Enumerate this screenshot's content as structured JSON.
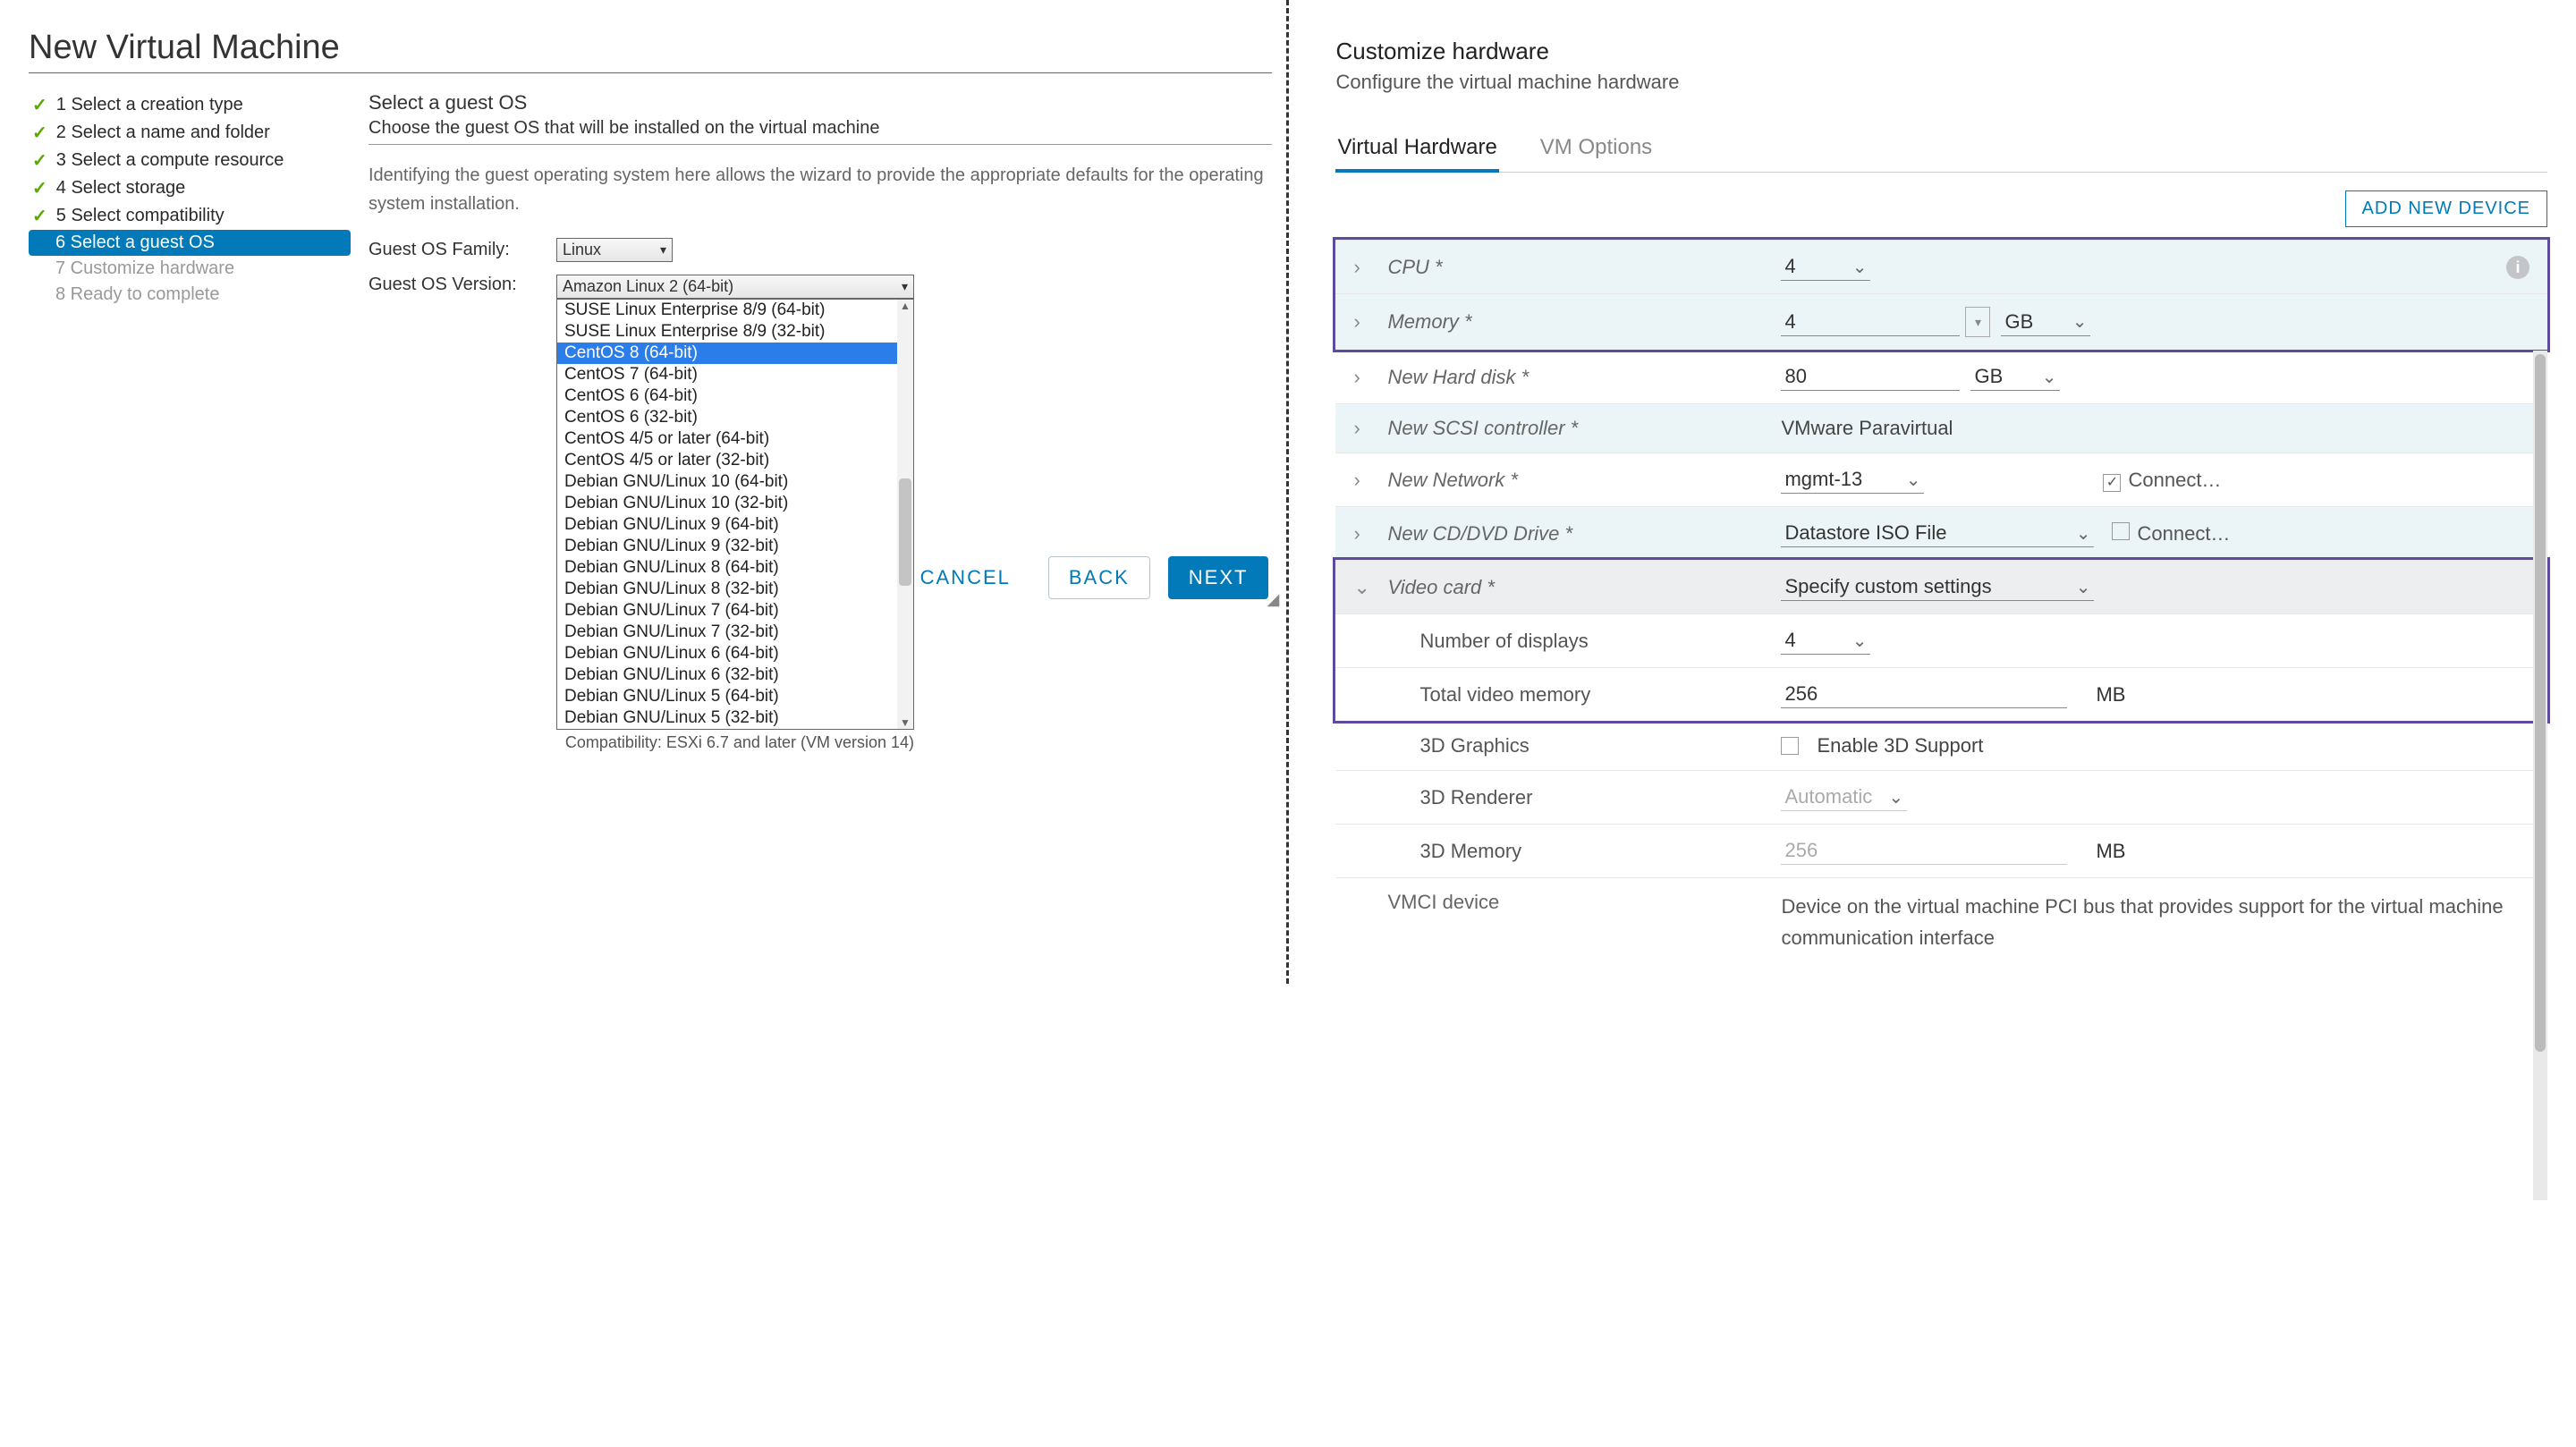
{
  "left": {
    "title": "New Virtual Machine",
    "steps": [
      {
        "num": "1",
        "label": "Select a creation type",
        "state": "done"
      },
      {
        "num": "2",
        "label": "Select a name and folder",
        "state": "done"
      },
      {
        "num": "3",
        "label": "Select a compute resource",
        "state": "done"
      },
      {
        "num": "4",
        "label": "Select storage",
        "state": "done"
      },
      {
        "num": "5",
        "label": "Select compatibility",
        "state": "done"
      },
      {
        "num": "6",
        "label": "Select a guest OS",
        "state": "active"
      },
      {
        "num": "7",
        "label": "Customize hardware",
        "state": "pending"
      },
      {
        "num": "8",
        "label": "Ready to complete",
        "state": "pending"
      }
    ],
    "heading": "Select a guest OS",
    "sub": "Choose the guest OS that will be installed on the virtual machine",
    "desc": "Identifying the guest operating system here allows the wizard to provide the appropriate defaults for the operating system installation.",
    "family_label": "Guest OS Family:",
    "family_value": "Linux",
    "version_label": "Guest OS Version:",
    "version_value": "Amazon Linux 2 (64-bit)",
    "options": [
      "SUSE Linux Enterprise 8/9 (64-bit)",
      "SUSE Linux Enterprise 8/9 (32-bit)",
      "CentOS 8 (64-bit)",
      "CentOS 7 (64-bit)",
      "CentOS 6 (64-bit)",
      "CentOS 6 (32-bit)",
      "CentOS 4/5 or later (64-bit)",
      "CentOS 4/5 or later (32-bit)",
      "Debian GNU/Linux 10 (64-bit)",
      "Debian GNU/Linux 10 (32-bit)",
      "Debian GNU/Linux 9 (64-bit)",
      "Debian GNU/Linux 9 (32-bit)",
      "Debian GNU/Linux 8 (64-bit)",
      "Debian GNU/Linux 8 (32-bit)",
      "Debian GNU/Linux 7 (64-bit)",
      "Debian GNU/Linux 7 (32-bit)",
      "Debian GNU/Linux 6 (64-bit)",
      "Debian GNU/Linux 6 (32-bit)",
      "Debian GNU/Linux 5 (64-bit)",
      "Debian GNU/Linux 5 (32-bit)"
    ],
    "highlight_index": 2,
    "compat": "Compatibility: ESXi 6.7 and later (VM version 14)",
    "buttons": {
      "cancel": "CANCEL",
      "back": "BACK",
      "next": "NEXT"
    }
  },
  "right": {
    "title": "Customize hardware",
    "sub": "Configure the virtual machine hardware",
    "tabs": {
      "hw": "Virtual Hardware",
      "opts": "VM Options"
    },
    "add": "ADD NEW DEVICE",
    "rows": {
      "cpu": {
        "label": "CPU *",
        "value": "4"
      },
      "memory": {
        "label": "Memory *",
        "value": "4",
        "unit": "GB"
      },
      "disk": {
        "label": "New Hard disk *",
        "value": "80",
        "unit": "GB"
      },
      "scsi": {
        "label": "New SCSI controller *",
        "value": "VMware Paravirtual"
      },
      "net": {
        "label": "New Network *",
        "value": "mgmt-13",
        "connect": "Connect…",
        "checked": true
      },
      "cd": {
        "label": "New CD/DVD Drive *",
        "value": "Datastore ISO File",
        "connect": "Connect…",
        "checked": false
      },
      "video": {
        "label": "Video card *",
        "value": "Specify custom settings"
      },
      "displays": {
        "label": "Number of displays",
        "value": "4"
      },
      "vmem": {
        "label": "Total video memory",
        "value": "256",
        "unit": "MB"
      },
      "gfx3d": {
        "label": "3D Graphics",
        "value": "Enable 3D Support"
      },
      "renderer": {
        "label": "3D Renderer",
        "value": "Automatic"
      },
      "mem3d": {
        "label": "3D Memory",
        "value": "256",
        "unit": "MB"
      },
      "vmci": {
        "label": "VMCI device",
        "value": "Device on the virtual machine PCI bus that provides support for the virtual machine communication interface"
      }
    }
  }
}
